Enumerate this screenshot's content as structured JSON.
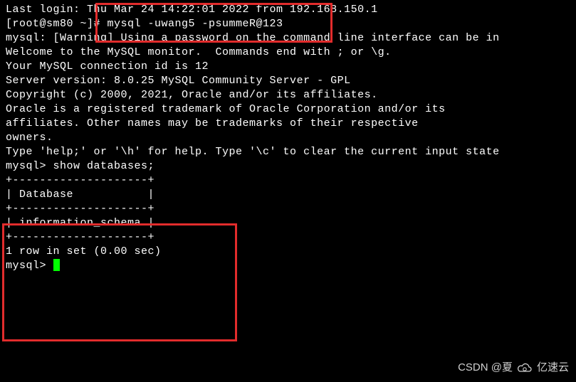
{
  "terminal": {
    "last_login": "Last login: Thu Mar 24 14:22:01 2022 from 192.168.150.1",
    "prompt_line": "[root@sm80 ~]# mysql -uwang5 -psummeR@123",
    "warning": "mysql: [Warning] Using a password on the command line interface can be in",
    "welcome1": "Welcome to the MySQL monitor.  Commands end with ; or \\g.",
    "welcome2": "Your MySQL connection id is 12",
    "welcome3": "Server version: 8.0.25 MySQL Community Server - GPL",
    "blank1": "",
    "copyright": "Copyright (c) 2000, 2021, Oracle and/or its affiliates.",
    "blank2": "",
    "trademark1": "Oracle is a registered trademark of Oracle Corporation and/or its",
    "trademark2": "affiliates. Other names may be trademarks of their respective",
    "trademark3": "owners.",
    "blank3": "",
    "help": "Type 'help;' or '\\h' for help. Type '\\c' to clear the current input state",
    "blank4": "",
    "query": "mysql> show databases;",
    "table_top": "+--------------------+",
    "table_header": "| Database           |",
    "table_mid": "+--------------------+",
    "table_row": "| information_schema |",
    "table_bot": "+--------------------+",
    "result": "1 row in set (0.00 sec)",
    "blank5": "",
    "prompt2": "mysql> "
  },
  "watermark": {
    "text": "CSDN @夏",
    "brand": "亿速云"
  }
}
